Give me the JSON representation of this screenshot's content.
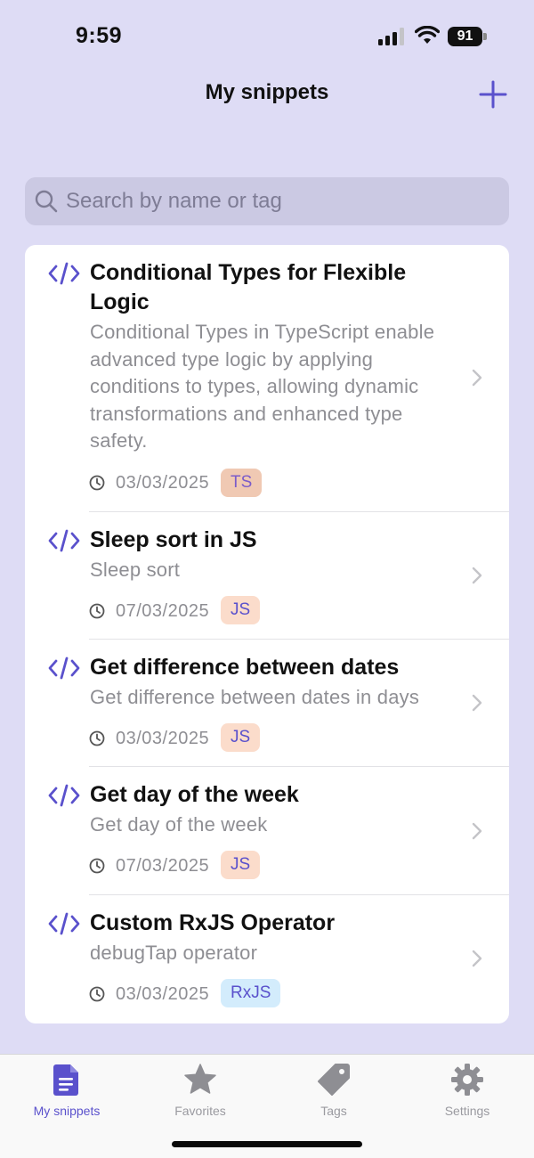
{
  "status_bar": {
    "time": "9:59",
    "battery": "91"
  },
  "nav": {
    "title": "My snippets"
  },
  "search": {
    "placeholder": "Search by name or tag"
  },
  "colors": {
    "accent": "#5a51cc",
    "background": "#dedcf5"
  },
  "snippets": [
    {
      "title": "Conditional Types for Flexible Logic",
      "description": "Conditional Types in TypeScript enable advanced type logic by applying conditions to types, allowing dynamic transformations and enhanced type safety.",
      "date": "03/03/2025",
      "tag": "TS"
    },
    {
      "title": "Sleep sort in JS",
      "description": "Sleep sort",
      "date": "07/03/2025",
      "tag": "JS"
    },
    {
      "title": "Get difference between dates",
      "description": "Get difference between dates in days",
      "date": "03/03/2025",
      "tag": "JS"
    },
    {
      "title": "Get day of the week",
      "description": "Get day of the week",
      "date": "07/03/2025",
      "tag": "JS"
    },
    {
      "title": "Custom RxJS Operator",
      "description": "debugTap operator",
      "date": "03/03/2025",
      "tag": "RxJS"
    }
  ],
  "tabs": [
    {
      "label": "My snippets",
      "icon": "document-icon",
      "active": true
    },
    {
      "label": "Favorites",
      "icon": "star-icon",
      "active": false
    },
    {
      "label": "Tags",
      "icon": "tag-icon",
      "active": false
    },
    {
      "label": "Settings",
      "icon": "gear-icon",
      "active": false
    }
  ]
}
